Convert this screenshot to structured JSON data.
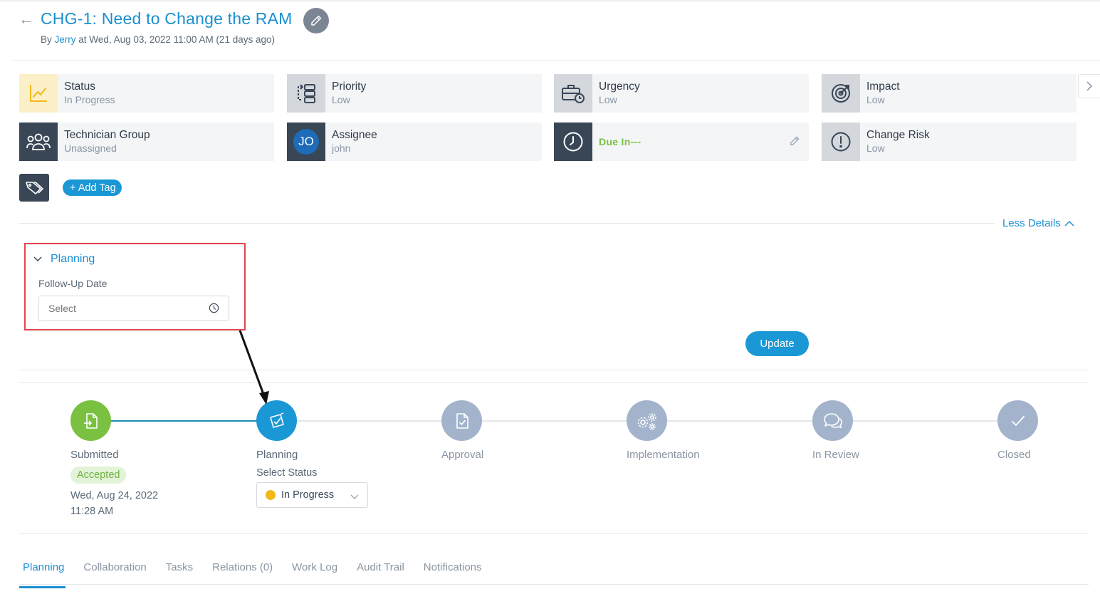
{
  "header": {
    "title": "CHG-1: Need to Change the RAM",
    "by_prefix": "By",
    "author": "Jerry",
    "timestamp": "at Wed, Aug 03, 2022 11:00 AM (21 days ago)"
  },
  "cards": {
    "status": {
      "label": "Status",
      "value": "In Progress"
    },
    "priority": {
      "label": "Priority",
      "value": "Low"
    },
    "urgency": {
      "label": "Urgency",
      "value": "Low"
    },
    "impact": {
      "label": "Impact",
      "value": "Low"
    },
    "technician_group": {
      "label": "Technician Group",
      "value": "Unassigned"
    },
    "assignee": {
      "label": "Assignee",
      "value": "john",
      "initials": "JO"
    },
    "due": {
      "label": "Due In---"
    },
    "change_risk": {
      "label": "Change Risk",
      "value": "Low"
    }
  },
  "tags": {
    "add_label": "+ Add Tag"
  },
  "details": {
    "toggle_label": "Less Details"
  },
  "planning_panel": {
    "title": "Planning",
    "follow_up_label": "Follow-Up Date",
    "follow_up_placeholder": "Select",
    "update_label": "Update"
  },
  "stepper": {
    "steps": [
      {
        "label": "Submitted",
        "state": "done"
      },
      {
        "label": "Planning",
        "state": "active"
      },
      {
        "label": "Approval",
        "state": "pending"
      },
      {
        "label": "Implementation",
        "state": "pending"
      },
      {
        "label": "In Review",
        "state": "pending"
      },
      {
        "label": "Closed",
        "state": "pending"
      }
    ],
    "submitted_badge": "Accepted",
    "submitted_date": "Wed, Aug 24, 2022",
    "submitted_time": "11:28 AM",
    "select_status_label": "Select Status",
    "current_status": "In Progress"
  },
  "tabs": [
    {
      "label": "Planning",
      "active": true
    },
    {
      "label": "Collaboration"
    },
    {
      "label": "Tasks"
    },
    {
      "label": "Relations (0)"
    },
    {
      "label": "Work Log"
    },
    {
      "label": "Audit Trail"
    },
    {
      "label": "Notifications"
    }
  ],
  "colors": {
    "accent": "#1a8fd1",
    "done": "#7ac142",
    "pending": "#a3b3cc",
    "highlight": "#e0474c",
    "status_dot": "#f3b81a"
  }
}
